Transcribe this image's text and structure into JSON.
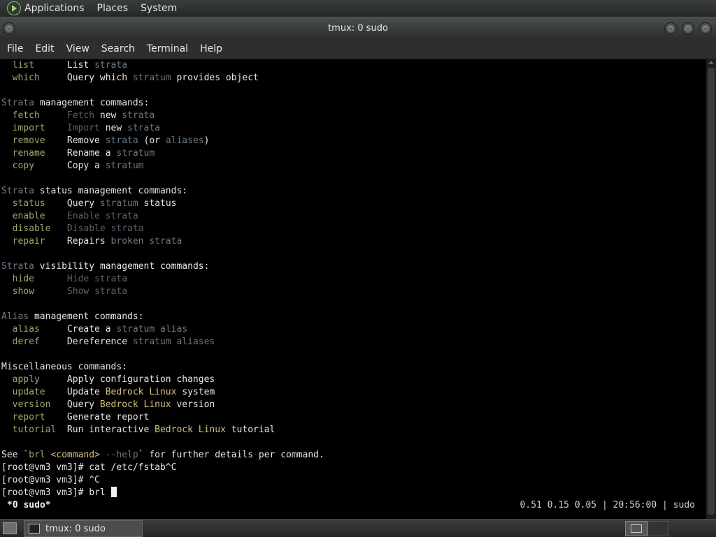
{
  "panel": {
    "menus": [
      "Applications",
      "Places",
      "System"
    ]
  },
  "window": {
    "title": "tmux: 0 sudo"
  },
  "menubar": {
    "items": [
      "File",
      "Edit",
      "View",
      "Search",
      "Terminal",
      "Help"
    ]
  },
  "terminal": {
    "lines": [
      [
        {
          "t": "  list      ",
          "c": "cmd"
        },
        {
          "t": "List ",
          "c": "wht"
        },
        {
          "t": "strata",
          "c": "str"
        }
      ],
      [
        {
          "t": "  which     ",
          "c": "cmd"
        },
        {
          "t": "Query which ",
          "c": "wht"
        },
        {
          "t": "stratum",
          "c": "str"
        },
        {
          "t": " provides object",
          "c": "wht"
        }
      ],
      [],
      [
        {
          "t": "Strata",
          "c": "str"
        },
        {
          "t": " management commands:",
          "c": "wht"
        }
      ],
      [
        {
          "t": "  fetch     ",
          "c": "cmd"
        },
        {
          "t": "Fetch ",
          "c": "dim"
        },
        {
          "t": "new ",
          "c": "wht"
        },
        {
          "t": "strata",
          "c": "str"
        }
      ],
      [
        {
          "t": "  import    ",
          "c": "cmd"
        },
        {
          "t": "Import ",
          "c": "dim"
        },
        {
          "t": "new ",
          "c": "wht"
        },
        {
          "t": "strata",
          "c": "str"
        }
      ],
      [
        {
          "t": "  remove    ",
          "c": "cmd"
        },
        {
          "t": "Remove ",
          "c": "wht"
        },
        {
          "t": "strata",
          "c": "str"
        },
        {
          "t": " (or ",
          "c": "wht"
        },
        {
          "t": "aliases",
          "c": "str"
        },
        {
          "t": ")",
          "c": "wht"
        }
      ],
      [
        {
          "t": "  rename    ",
          "c": "cmd"
        },
        {
          "t": "Rename a ",
          "c": "wht"
        },
        {
          "t": "stratum",
          "c": "str"
        }
      ],
      [
        {
          "t": "  copy      ",
          "c": "cmd"
        },
        {
          "t": "Copy a ",
          "c": "wht"
        },
        {
          "t": "stratum",
          "c": "str"
        }
      ],
      [],
      [
        {
          "t": "Strata",
          "c": "str"
        },
        {
          "t": " status management commands:",
          "c": "wht"
        }
      ],
      [
        {
          "t": "  status    ",
          "c": "cmd"
        },
        {
          "t": "Query ",
          "c": "wht"
        },
        {
          "t": "stratum",
          "c": "str"
        },
        {
          "t": " status",
          "c": "wht"
        }
      ],
      [
        {
          "t": "  enable    ",
          "c": "cmd"
        },
        {
          "t": "Enable strata",
          "c": "dim"
        }
      ],
      [
        {
          "t": "  disable   ",
          "c": "cmd"
        },
        {
          "t": "Disable strata",
          "c": "dim"
        }
      ],
      [
        {
          "t": "  repair    ",
          "c": "cmd"
        },
        {
          "t": "Repairs ",
          "c": "wht"
        },
        {
          "t": "broken strata",
          "c": "str"
        }
      ],
      [],
      [
        {
          "t": "Strata",
          "c": "str"
        },
        {
          "t": " visibility management commands:",
          "c": "wht"
        }
      ],
      [
        {
          "t": "  hide      ",
          "c": "cmd"
        },
        {
          "t": "Hide strata",
          "c": "dim"
        }
      ],
      [
        {
          "t": "  show      ",
          "c": "cmd"
        },
        {
          "t": "Show strata",
          "c": "dim"
        }
      ],
      [],
      [
        {
          "t": "Alias",
          "c": "str"
        },
        {
          "t": " management commands:",
          "c": "wht"
        }
      ],
      [
        {
          "t": "  alias     ",
          "c": "cmd"
        },
        {
          "t": "Create a ",
          "c": "wht"
        },
        {
          "t": "stratum alias",
          "c": "str"
        }
      ],
      [
        {
          "t": "  deref     ",
          "c": "cmd"
        },
        {
          "t": "Dereference ",
          "c": "wht"
        },
        {
          "t": "stratum aliases",
          "c": "str"
        }
      ],
      [],
      [
        {
          "t": "Miscellaneous commands:",
          "c": "wht"
        }
      ],
      [
        {
          "t": "  apply     ",
          "c": "cmd"
        },
        {
          "t": "Apply configuration changes",
          "c": "wht"
        }
      ],
      [
        {
          "t": "  update    ",
          "c": "cmd"
        },
        {
          "t": "Update ",
          "c": "wht"
        },
        {
          "t": "Bedrock Linux",
          "c": "yel"
        },
        {
          "t": " system",
          "c": "wht"
        }
      ],
      [
        {
          "t": "  version   ",
          "c": "cmd"
        },
        {
          "t": "Query ",
          "c": "wht"
        },
        {
          "t": "Bedrock Linux",
          "c": "yel"
        },
        {
          "t": " version",
          "c": "wht"
        }
      ],
      [
        {
          "t": "  report    ",
          "c": "cmd"
        },
        {
          "t": "Generate report",
          "c": "wht"
        }
      ],
      [
        {
          "t": "  tutorial  ",
          "c": "cmd"
        },
        {
          "t": "Run interactive ",
          "c": "wht"
        },
        {
          "t": "Bedrock Linux",
          "c": "yel"
        },
        {
          "t": " tutorial",
          "c": "wht"
        }
      ],
      [],
      [
        {
          "t": "See `",
          "c": "wht"
        },
        {
          "t": "brl ",
          "c": "cmd"
        },
        {
          "t": "<command>",
          "c": "yel"
        },
        {
          "t": " --help",
          "c": "str"
        },
        {
          "t": "` for further details per command.",
          "c": "wht"
        }
      ],
      [
        {
          "t": "[root@vm3 vm3]# cat /etc/fstab^C",
          "c": "wht"
        }
      ],
      [
        {
          "t": "[root@vm3 vm3]# ^C",
          "c": "wht"
        }
      ],
      [
        {
          "t": "[root@vm3 vm3]# brl ",
          "c": "wht"
        }
      ]
    ]
  },
  "tmux": {
    "status_left": "*0 sudo*",
    "status_right": "0.51 0.15 0.05 | 20:56:00 | sudo"
  },
  "taskbar": {
    "task_label": "tmux: 0 sudo"
  }
}
